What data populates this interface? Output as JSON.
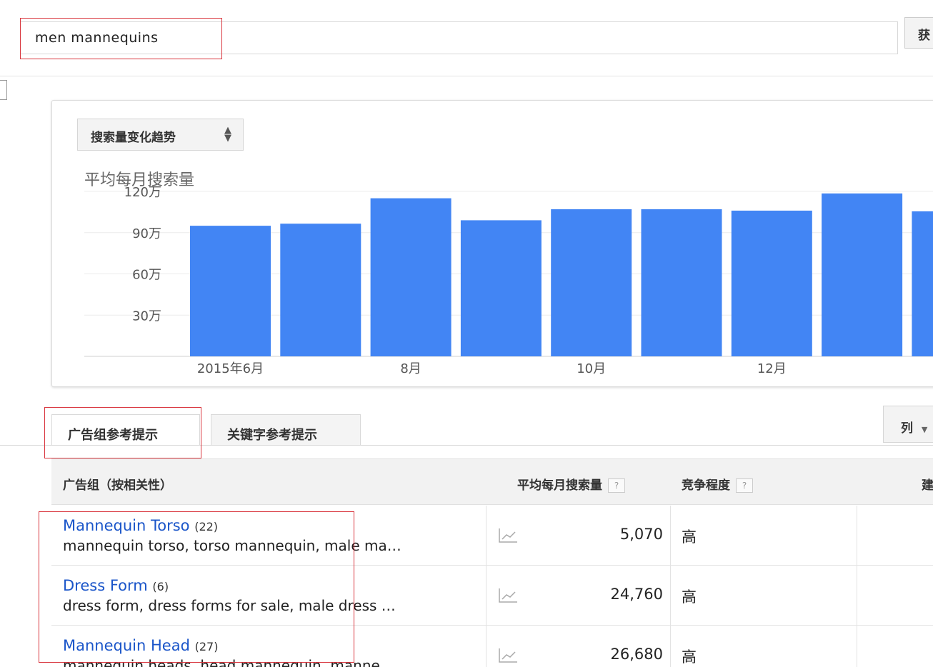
{
  "search": {
    "value": "men mannequins",
    "get_button_label": "获"
  },
  "chart_panel": {
    "selector_label": "搜索量变化趋势",
    "title": "平均每月搜索量"
  },
  "chart_data": {
    "type": "bar",
    "title": "平均每月搜索量",
    "yticks": [
      "30万",
      "60万",
      "90万",
      "120万"
    ],
    "xticks": [
      {
        "label": "2015年6月",
        "index": 0
      },
      {
        "label": "8月",
        "index": 2
      },
      {
        "label": "10月",
        "index": 4
      },
      {
        "label": "12月",
        "index": 6
      }
    ],
    "ylim": [
      0,
      1200000
    ],
    "values": [
      950000,
      965000,
      1150000,
      990000,
      1070000,
      1070000,
      1060000,
      1185000,
      1055000
    ],
    "color": "#4285f4",
    "grid": true
  },
  "tabs": [
    {
      "label": "广告组参考提示",
      "active": true
    },
    {
      "label": "关键字参考提示",
      "active": false
    }
  ],
  "columns_button_label": "列",
  "table": {
    "headers": {
      "group": "广告组（按相关性）",
      "volume": "平均每月搜索量",
      "competition": "竞争程度",
      "suggested": "建",
      "help": "?"
    },
    "rows": [
      {
        "name": "Mannequin Torso",
        "count": "(22)",
        "keywords": "mannequin torso, torso mannequin, male ma…",
        "volume": "5,070",
        "competition": "高"
      },
      {
        "name": "Dress Form",
        "count": "(6)",
        "keywords": "dress form, dress forms for sale, male dress …",
        "volume": "24,760",
        "competition": "高"
      },
      {
        "name": "Mannequin Head",
        "count": "(27)",
        "keywords": "mannequin heads, head mannequin, manne…",
        "volume": "26,680",
        "competition": "高"
      }
    ]
  }
}
